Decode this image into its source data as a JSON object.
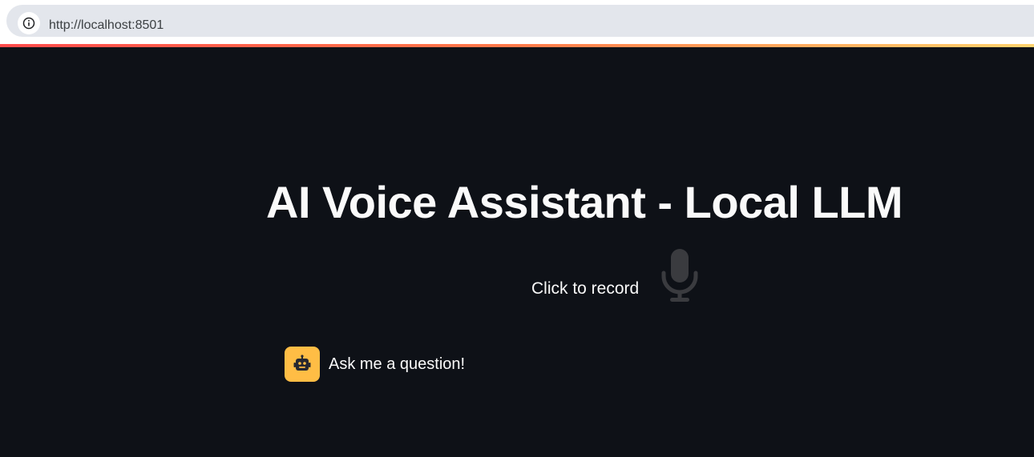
{
  "browser": {
    "url": "http://localhost:8501",
    "info_icon": "info-icon"
  },
  "colors": {
    "background": "#0e1117",
    "header_gradient": [
      "#ff4b4b",
      "#ffd36e"
    ],
    "avatar_background": "#ffbd45",
    "text": "#fafafa",
    "mic_icon": "#3a3b3f"
  },
  "main": {
    "title": "AI Voice Assistant - Local LLM",
    "recorder": {
      "label": "Click to record",
      "icon": "microphone-icon"
    },
    "chat": {
      "messages": [
        {
          "role": "assistant",
          "avatar_icon": "robot-icon",
          "text": "Ask me a question!"
        }
      ]
    }
  }
}
